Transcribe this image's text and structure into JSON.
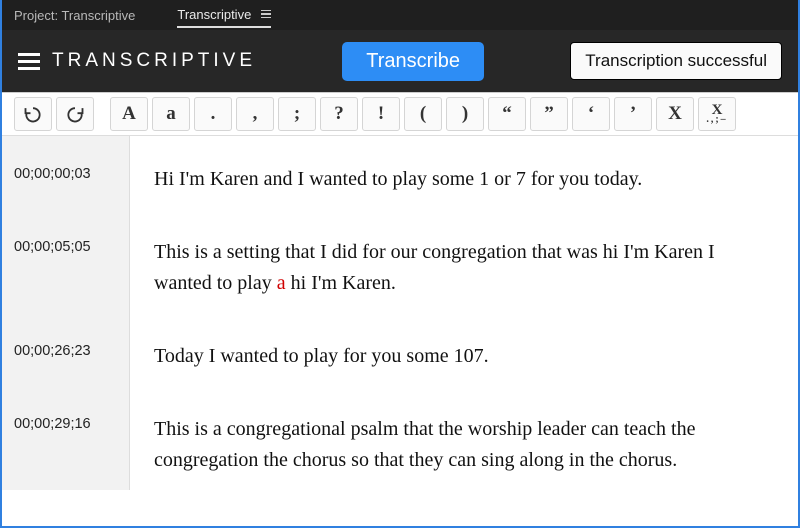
{
  "topbar": {
    "project_label": "Project: Transcriptive",
    "tab_label": "Transcriptive"
  },
  "header": {
    "brand": "TRANSCRIPTIVE",
    "transcribe_label": "Transcribe",
    "status_label": "Transcription successful"
  },
  "toolbar": {
    "undo": "undo",
    "redo": "redo",
    "buttons": [
      "A",
      "a",
      ".",
      ",",
      ";",
      "?",
      "!",
      "(",
      ")",
      "“",
      "”",
      "‘",
      "’",
      "X"
    ],
    "combo_top": "X",
    "combo_sub": ".,;–"
  },
  "transcript": [
    {
      "tc": "00;00;00;03",
      "text": "Hi I'm Karen and I wanted to play some 1 or 7 for you today."
    },
    {
      "tc": "00;00;05;05",
      "text_parts": [
        "This is a setting that I did for our congregation that was hi I'm Karen I wanted to play ",
        {
          "red": "a"
        },
        " hi I'm Karen."
      ]
    },
    {
      "tc": "00;00;26;23",
      "text": "Today I wanted to play for you some 107."
    },
    {
      "tc": "00;00;29;16",
      "text": "This is a congregational psalm that the worship leader can teach the congregation the chorus so that they can sing along in the chorus."
    }
  ]
}
